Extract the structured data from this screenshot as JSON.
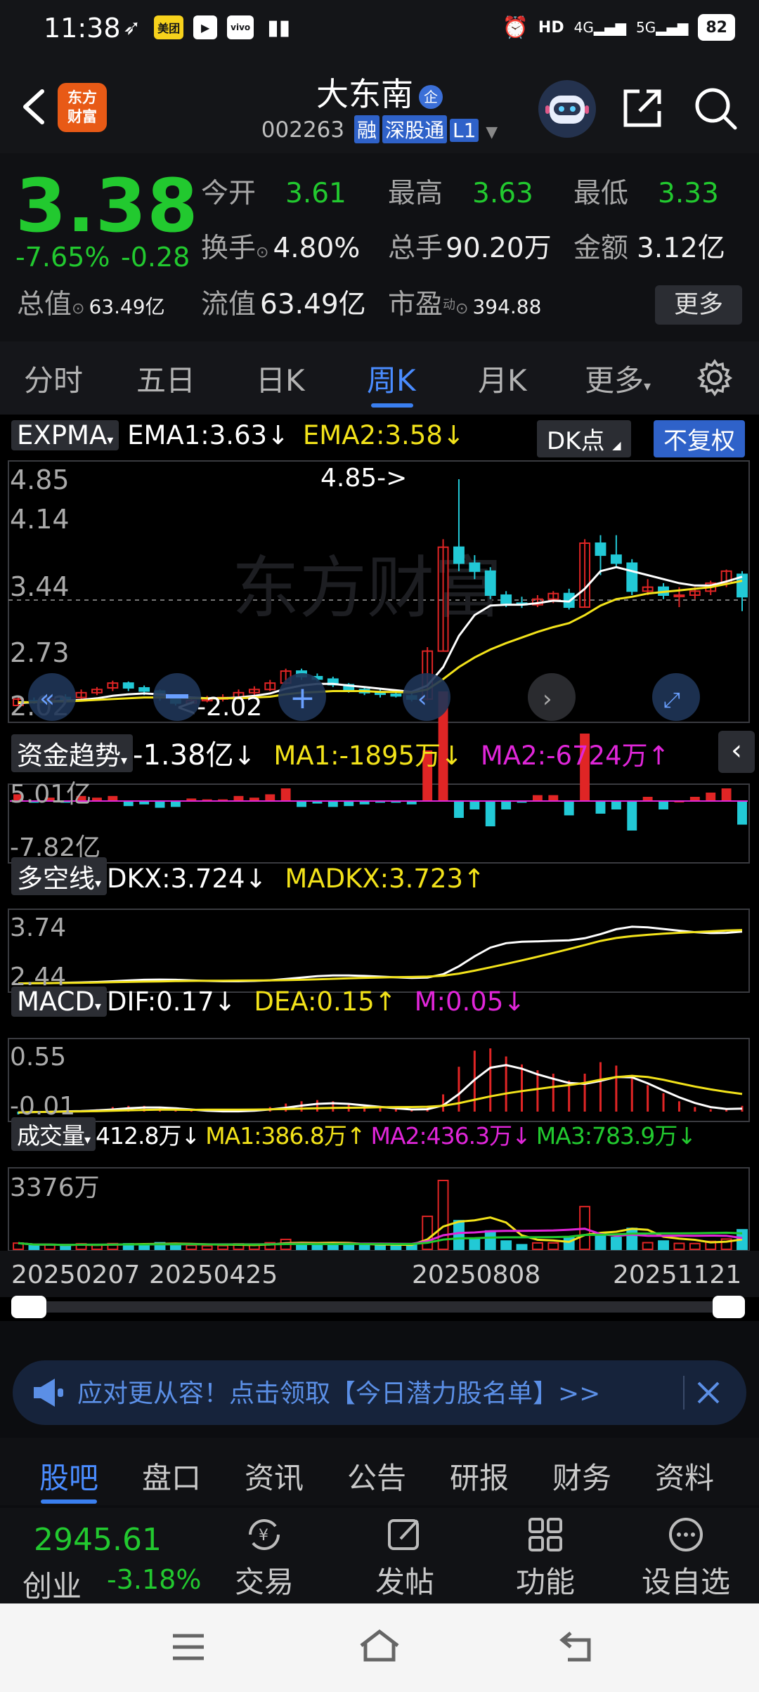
{
  "status_bar": {
    "time": "11:38",
    "battery": "82",
    "net1": "4G",
    "net2": "5G"
  },
  "header": {
    "title": "大东南",
    "badge": "企",
    "code": "002263",
    "tags": [
      "融",
      "深股通",
      "L1"
    ],
    "logo_lines": [
      "东方",
      "财富"
    ]
  },
  "quote": {
    "price": "3.38",
    "change_pct": "-7.65%",
    "change": "-0.28",
    "rows": [
      [
        {
          "label": "今开",
          "value": "3.61"
        },
        {
          "label": "最高",
          "value": "3.63"
        },
        {
          "label": "最低",
          "value": "3.33"
        }
      ],
      [
        {
          "label": "换手",
          "value": "4.80%"
        },
        {
          "label": "总手",
          "value": "90.20万"
        },
        {
          "label": "金额",
          "value": "3.12亿"
        }
      ],
      [
        {
          "label": "总值",
          "value": "63.49亿"
        },
        {
          "label": "流值",
          "value": "63.49亿"
        },
        {
          "label": "市盈",
          "sup": "动",
          "value": "394.88"
        }
      ]
    ],
    "more_label": "更多"
  },
  "tabs": [
    "分时",
    "五日",
    "日K",
    "周K",
    "月K",
    "更多",
    "settings"
  ],
  "active_tab": "周K",
  "main_chart": {
    "indicator": "EXPMA",
    "ema1": "EMA1:3.63",
    "ema2": "EMA2:3.58",
    "dk_label": "DK点",
    "fq_label": "不复权",
    "y_ticks": [
      "4.85",
      "4.14",
      "3.44",
      "2.73",
      "2.02"
    ],
    "high_marker": "4.85->",
    "low_marker": "<-2.02",
    "watermark": "东方财富"
  },
  "fund_panel": {
    "indicator": "资金趋势",
    "val": "-1.38亿",
    "ma1": "MA1:-1895万",
    "ma2": "MA2:-6724万",
    "y_ticks": [
      "5.01亿",
      "-7.82亿"
    ]
  },
  "dkx_panel": {
    "indicator": "多空线",
    "dkx": "DKX:3.724",
    "madkx": "MADKX:3.723",
    "y_ticks": [
      "3.74",
      "2.44"
    ]
  },
  "macd_panel": {
    "indicator": "MACD",
    "dif": "DIF:0.17",
    "dea": "DEA:0.15",
    "m": "M:0.05",
    "y_ticks": [
      "0.55",
      "-0.01"
    ]
  },
  "vol_panel": {
    "indicator": "成交量",
    "vol": "412.8万",
    "ma1": "MA1:386.8万",
    "ma2": "MA2:436.3万",
    "ma3": "MA3:783.9万",
    "y_ticks": [
      "3376万"
    ]
  },
  "x_dates": [
    "20250207",
    "20250425",
    "20250808",
    "20251121"
  ],
  "promo": {
    "text": "应对更从容！点击领取【今日潜力股名单】>>"
  },
  "bottom_tabs": [
    "股吧",
    "盘口",
    "资讯",
    "公告",
    "研报",
    "财务",
    "资料"
  ],
  "bottom_active": "股吧",
  "index": {
    "value": "2945.61",
    "name": "创业",
    "change": "-3.18%"
  },
  "actions": [
    "交易",
    "发帖",
    "功能",
    "设自选"
  ],
  "colors": {
    "up": "#e02525",
    "down": "#22c9d6",
    "price_down": "#22c92f",
    "accent": "#3a7ff0",
    "ema2": "#f2e21a",
    "ma2": "#e026d9"
  },
  "chart_data": [
    {
      "type": "candlestick",
      "title": "周K",
      "ylim": [
        2.02,
        4.85
      ],
      "candles": [
        {
          "o": 2.02,
          "c": 2.1,
          "h": 2.14,
          "l": 2.02
        },
        {
          "o": 2.08,
          "c": 2.06,
          "h": 2.12,
          "l": 2.04
        },
        {
          "o": 2.06,
          "c": 2.1,
          "h": 2.14,
          "l": 2.04
        },
        {
          "o": 2.12,
          "c": 2.1,
          "h": 2.16,
          "l": 2.08
        },
        {
          "o": 2.12,
          "c": 2.18,
          "h": 2.22,
          "l": 2.1
        },
        {
          "o": 2.18,
          "c": 2.22,
          "h": 2.25,
          "l": 2.15
        },
        {
          "o": 2.24,
          "c": 2.3,
          "h": 2.33,
          "l": 2.2
        },
        {
          "o": 2.3,
          "c": 2.24,
          "h": 2.32,
          "l": 2.2
        },
        {
          "o": 2.24,
          "c": 2.2,
          "h": 2.27,
          "l": 2.15
        },
        {
          "o": 2.2,
          "c": 2.12,
          "h": 2.22,
          "l": 2.08
        },
        {
          "o": 2.12,
          "c": 2.05,
          "h": 2.14,
          "l": 2.02
        },
        {
          "o": 2.05,
          "c": 2.08,
          "h": 2.12,
          "l": 2.03
        },
        {
          "o": 2.08,
          "c": 2.1,
          "h": 2.14,
          "l": 2.06
        },
        {
          "o": 2.1,
          "c": 2.12,
          "h": 2.16,
          "l": 2.07
        },
        {
          "o": 2.12,
          "c": 2.18,
          "h": 2.22,
          "l": 2.1
        },
        {
          "o": 2.18,
          "c": 2.22,
          "h": 2.26,
          "l": 2.15
        },
        {
          "o": 2.22,
          "c": 2.3,
          "h": 2.34,
          "l": 2.2
        },
        {
          "o": 2.3,
          "c": 2.45,
          "h": 2.48,
          "l": 2.28
        },
        {
          "o": 2.45,
          "c": 2.38,
          "h": 2.48,
          "l": 2.34
        },
        {
          "o": 2.38,
          "c": 2.35,
          "h": 2.42,
          "l": 2.32
        },
        {
          "o": 2.35,
          "c": 2.28,
          "h": 2.38,
          "l": 2.25
        },
        {
          "o": 2.28,
          "c": 2.22,
          "h": 2.3,
          "l": 2.18
        },
        {
          "o": 2.22,
          "c": 2.18,
          "h": 2.25,
          "l": 2.15
        },
        {
          "o": 2.18,
          "c": 2.16,
          "h": 2.22,
          "l": 2.12
        },
        {
          "o": 2.16,
          "c": 2.14,
          "h": 2.2,
          "l": 2.12
        },
        {
          "o": 2.14,
          "c": 2.1,
          "h": 2.17,
          "l": 2.07
        },
        {
          "o": 2.1,
          "c": 2.7,
          "h": 2.75,
          "l": 2.08
        },
        {
          "o": 2.7,
          "c": 4.0,
          "h": 4.1,
          "l": 2.7
        },
        {
          "o": 4.0,
          "c": 3.8,
          "h": 4.85,
          "l": 3.7
        },
        {
          "o": 3.8,
          "c": 3.7,
          "h": 3.9,
          "l": 3.6
        },
        {
          "o": 3.7,
          "c": 3.4,
          "h": 3.75,
          "l": 3.35
        },
        {
          "o": 3.4,
          "c": 3.3,
          "h": 3.45,
          "l": 3.25
        },
        {
          "o": 3.3,
          "c": 3.28,
          "h": 3.38,
          "l": 3.24
        },
        {
          "o": 3.28,
          "c": 3.35,
          "h": 3.4,
          "l": 3.25
        },
        {
          "o": 3.35,
          "c": 3.42,
          "h": 3.45,
          "l": 3.3
        },
        {
          "o": 3.42,
          "c": 3.25,
          "h": 3.48,
          "l": 3.22
        },
        {
          "o": 3.25,
          "c": 4.05,
          "h": 4.1,
          "l": 3.25
        },
        {
          "o": 4.05,
          "c": 3.9,
          "h": 4.15,
          "l": 3.65
        },
        {
          "o": 3.9,
          "c": 3.8,
          "h": 4.15,
          "l": 3.75
        },
        {
          "o": 3.8,
          "c": 3.45,
          "h": 3.85,
          "l": 3.4
        },
        {
          "o": 3.45,
          "c": 3.5,
          "h": 3.6,
          "l": 3.4
        },
        {
          "o": 3.5,
          "c": 3.4,
          "h": 3.55,
          "l": 3.35
        },
        {
          "o": 3.4,
          "c": 3.4,
          "h": 3.5,
          "l": 3.25
        },
        {
          "o": 3.4,
          "c": 3.45,
          "h": 3.5,
          "l": 3.35
        },
        {
          "o": 3.45,
          "c": 3.55,
          "h": 3.58,
          "l": 3.4
        },
        {
          "o": 3.55,
          "c": 3.7,
          "h": 3.72,
          "l": 3.5
        },
        {
          "o": 3.66,
          "c": 3.38,
          "h": 3.7,
          "l": 3.2
        }
      ],
      "ema1": [
        2.05,
        2.06,
        2.07,
        2.08,
        2.09,
        2.11,
        2.14,
        2.16,
        2.17,
        2.16,
        2.14,
        2.12,
        2.11,
        2.11,
        2.12,
        2.14,
        2.17,
        2.23,
        2.27,
        2.29,
        2.29,
        2.27,
        2.25,
        2.23,
        2.21,
        2.19,
        2.27,
        2.5,
        2.89,
        3.15,
        3.27,
        3.28,
        3.28,
        3.3,
        3.33,
        3.32,
        3.48,
        3.7,
        3.75,
        3.7,
        3.65,
        3.6,
        3.55,
        3.52,
        3.52,
        3.57,
        3.63
      ],
      "ema2": [
        2.06,
        2.06,
        2.07,
        2.07,
        2.08,
        2.09,
        2.1,
        2.11,
        2.12,
        2.12,
        2.12,
        2.11,
        2.11,
        2.11,
        2.11,
        2.12,
        2.13,
        2.16,
        2.18,
        2.19,
        2.2,
        2.2,
        2.2,
        2.19,
        2.19,
        2.18,
        2.22,
        2.35,
        2.5,
        2.62,
        2.72,
        2.8,
        2.87,
        2.94,
        3.0,
        3.05,
        3.15,
        3.27,
        3.35,
        3.38,
        3.42,
        3.44,
        3.46,
        3.48,
        3.5,
        3.54,
        3.58
      ]
    },
    {
      "type": "bar",
      "title": "资金趋势",
      "ylim": [
        -7.82,
        5.01
      ]
    },
    {
      "type": "line",
      "title": "多空线",
      "ylim": [
        2.44,
        3.74
      ]
    },
    {
      "type": "bar",
      "title": "MACD",
      "ylim": [
        -0.01,
        0.55
      ]
    },
    {
      "type": "bar",
      "title": "成交量",
      "ylim": [
        0,
        3376
      ]
    }
  ]
}
